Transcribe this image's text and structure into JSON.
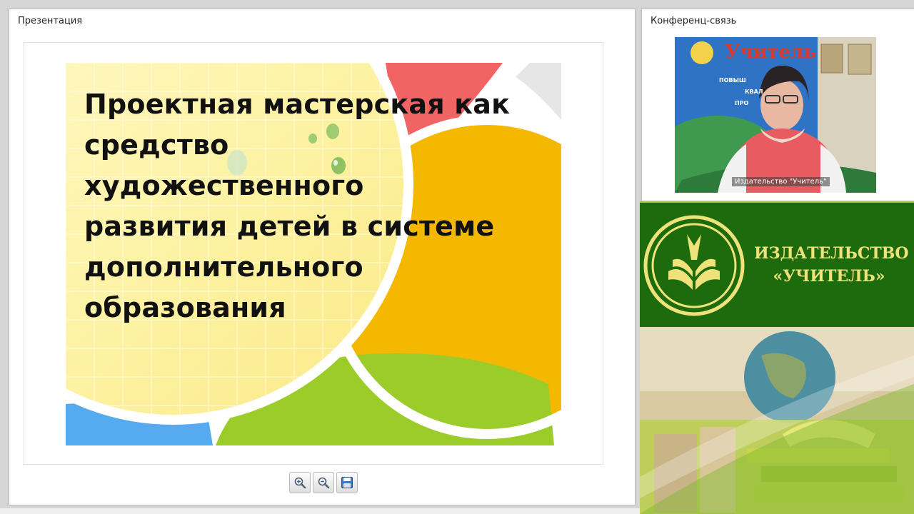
{
  "presentation_panel": {
    "title": "Презентация",
    "slide": {
      "title": "Проектная мастерская как\nсредство\nхудожественного\nразвития детей в системе\nдополнительного\nобразования"
    },
    "toolbar": {
      "zoom_in_icon": "zoom-in-icon",
      "zoom_out_icon": "zoom-out-icon",
      "save_icon": "save-icon"
    }
  },
  "conference_panel": {
    "title": "Конференц-связь",
    "video_caption": "Издательство \"Учитель\"",
    "backdrop_text": {
      "brand": "Учитель",
      "bullets": [
        "ПОВЫШ",
        "КВАЛ",
        "ПРО"
      ]
    }
  },
  "banner": {
    "line1": "ИЗДАТЕЛЬСТВО",
    "line2": "«УЧИТЕЛЬ»"
  },
  "colors": {
    "banner_green": "#1e6b0e",
    "banner_text": "#f0e27a",
    "slide_red": "#f06464",
    "slide_orange": "#f5b800",
    "slide_green": "#9ccc2a",
    "slide_blue": "#55aaf0"
  }
}
